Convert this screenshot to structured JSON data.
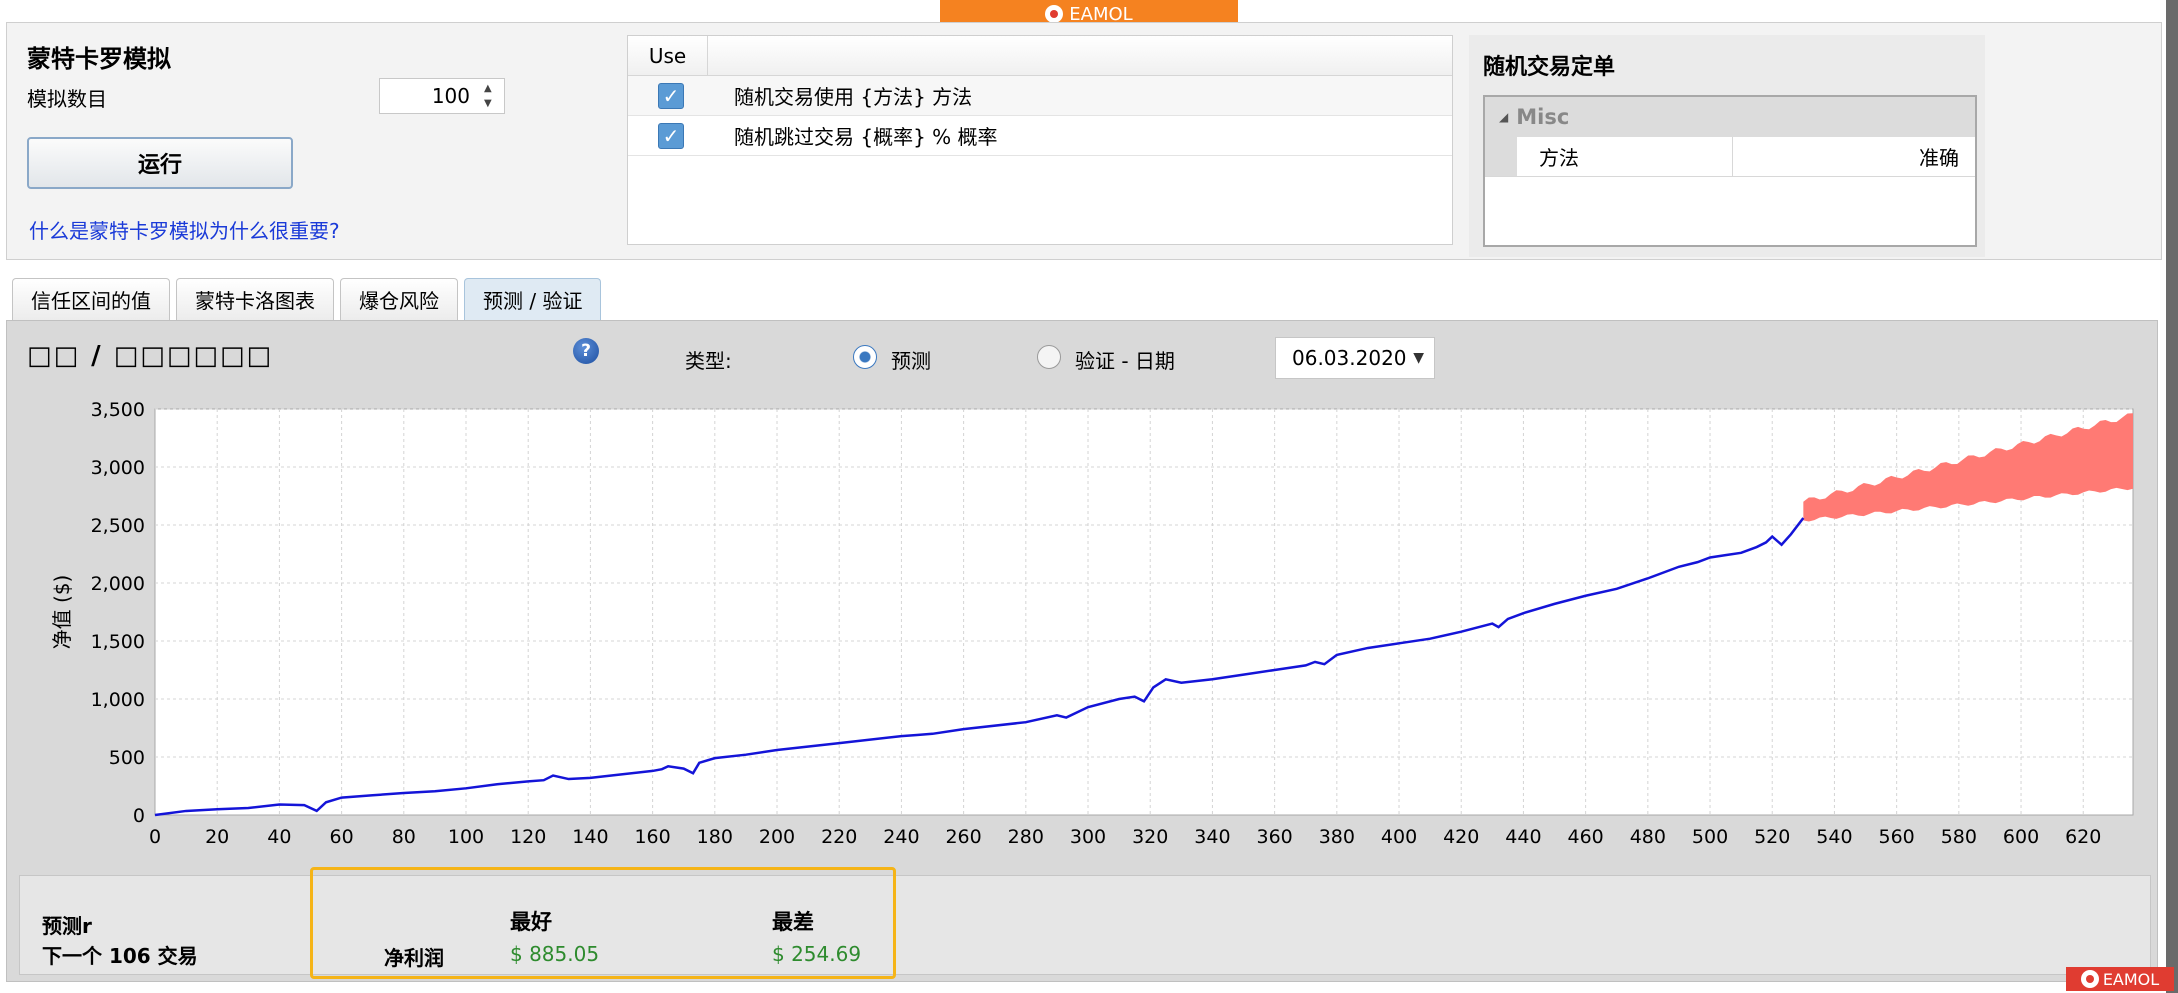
{
  "watermark": {
    "text": "EAMOL"
  },
  "monte_carlo": {
    "title": "蒙特卡罗模拟",
    "count_label": "模拟数目",
    "count_value": "100",
    "run_label": "运行",
    "link_text": "什么是蒙特卡罗模拟为什么很重要?"
  },
  "use_table": {
    "header": "Use",
    "rows": [
      {
        "label": "随机交易使用 {方法} 方法",
        "checked": true
      },
      {
        "label": "随机跳过交易 {概率} % 概率",
        "checked": true
      }
    ]
  },
  "random_panel": {
    "title": "随机交易定单",
    "category": "Misc",
    "prop_name": "方法",
    "prop_value": "准确"
  },
  "tabs": [
    {
      "label": "信任区间的值",
      "active": false
    },
    {
      "label": "蒙特卡洛图表",
      "active": false
    },
    {
      "label": "爆仓风险",
      "active": false
    },
    {
      "label": "预测 / 验证",
      "active": true
    }
  ],
  "content": {
    "title": "□□ / □□□□□□",
    "type_label": "类型:",
    "radio_predict": "预测",
    "radio_validate": "验证 - 日期",
    "date_value": "06.03.2020",
    "help": "?"
  },
  "chart_data": {
    "type": "line",
    "ylabel": "净值 ($)",
    "xlabel": "",
    "xlim": [
      0,
      636
    ],
    "ylim": [
      0,
      3500
    ],
    "x_ticks": [
      0,
      20,
      40,
      60,
      80,
      100,
      120,
      140,
      160,
      180,
      200,
      220,
      240,
      260,
      280,
      300,
      320,
      340,
      360,
      380,
      400,
      420,
      440,
      460,
      480,
      500,
      520,
      540,
      560,
      580,
      600,
      620
    ],
    "y_ticks": [
      0,
      500,
      1000,
      1500,
      2000,
      2500,
      3000,
      3500
    ],
    "y_tick_labels": [
      "0",
      "500",
      "1,000",
      "1,500",
      "2,000",
      "2,500",
      "3,000",
      "3,500"
    ],
    "grid": true,
    "series": [
      {
        "color": "#1414d8",
        "x": [
          0,
          10,
          20,
          30,
          40,
          48,
          52,
          55,
          60,
          70,
          80,
          90,
          100,
          110,
          120,
          125,
          128,
          133,
          140,
          150,
          160,
          163,
          165,
          170,
          173,
          175,
          180,
          190,
          200,
          220,
          240,
          245,
          250,
          260,
          280,
          290,
          293,
          300,
          310,
          315,
          318,
          321,
          325,
          330,
          340,
          350,
          360,
          370,
          373,
          376,
          380,
          390,
          400,
          410,
          420,
          430,
          432,
          435,
          440,
          450,
          460,
          470,
          480,
          490,
          496,
          500,
          505,
          510,
          515,
          518,
          520,
          523,
          526,
          530
        ],
        "y": [
          0,
          35,
          50,
          60,
          90,
          85,
          35,
          110,
          150,
          170,
          190,
          205,
          230,
          265,
          290,
          300,
          340,
          310,
          320,
          350,
          380,
          395,
          420,
          400,
          360,
          450,
          490,
          520,
          560,
          620,
          680,
          690,
          700,
          740,
          800,
          860,
          840,
          930,
          1000,
          1020,
          980,
          1100,
          1170,
          1140,
          1170,
          1210,
          1250,
          1290,
          1320,
          1300,
          1380,
          1440,
          1480,
          1520,
          1580,
          1650,
          1620,
          1690,
          1740,
          1820,
          1890,
          1950,
          2040,
          2140,
          2180,
          2220,
          2240,
          2260,
          2310,
          2350,
          2400,
          2330,
          2420,
          2560
        ]
      }
    ],
    "band": {
      "color": "#ff7a74",
      "x": [
        530,
        636
      ],
      "upper": [
        2700,
        3450
      ],
      "lower": [
        2540,
        2820
      ]
    }
  },
  "summary": {
    "label_line1": "预测r",
    "label_line2": "下一个 106 交易",
    "best_header": "最好",
    "worst_header": "最差",
    "net_profit_label": "净利润",
    "best_value": "$ 885.05",
    "worst_value": "$ 254.69"
  }
}
